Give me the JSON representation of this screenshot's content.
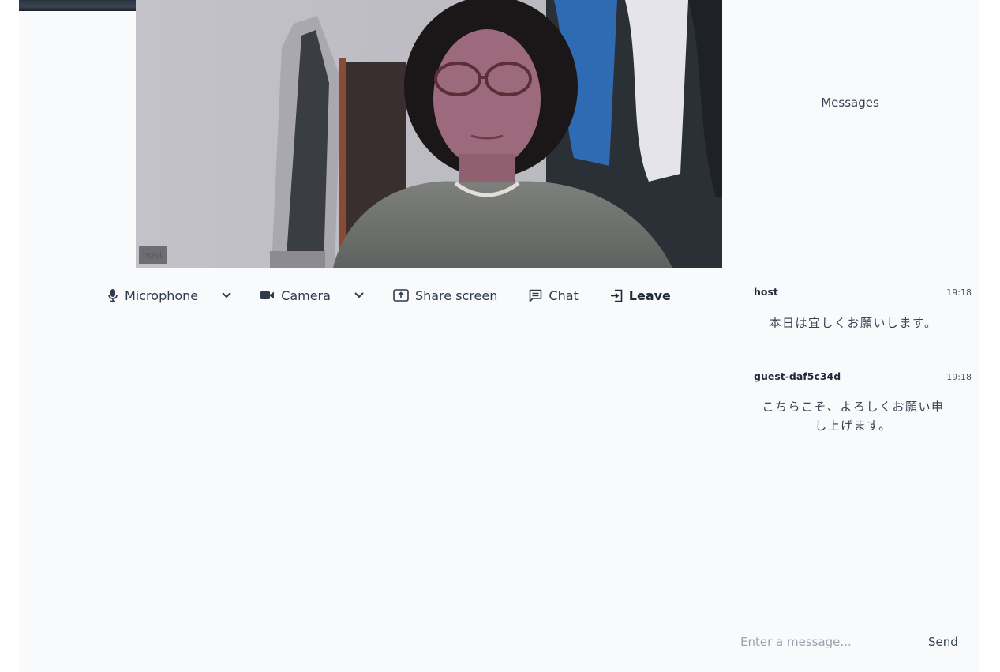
{
  "video": {
    "participant_name": "host"
  },
  "controls": {
    "microphone_label": "Microphone",
    "camera_label": "Camera",
    "share_label": "Share screen",
    "chat_label": "Chat",
    "leave_label": "Leave"
  },
  "chat": {
    "title": "Messages",
    "messages": [
      {
        "author": "host",
        "time": "19:18",
        "text": "本日は宜しくお願いします。"
      },
      {
        "author": "guest-daf5c34d",
        "time": "19:18",
        "text": "こちらこそ、よろしくお願い申し上げます。"
      }
    ],
    "input_placeholder": "Enter a message...",
    "send_label": "Send"
  },
  "icons": {
    "microphone": "microphone-icon",
    "camera": "video-camera-icon",
    "share": "share-screen-icon",
    "chat": "chat-icon",
    "leave": "leave-icon",
    "dropdown": "chevron-down-icon"
  }
}
